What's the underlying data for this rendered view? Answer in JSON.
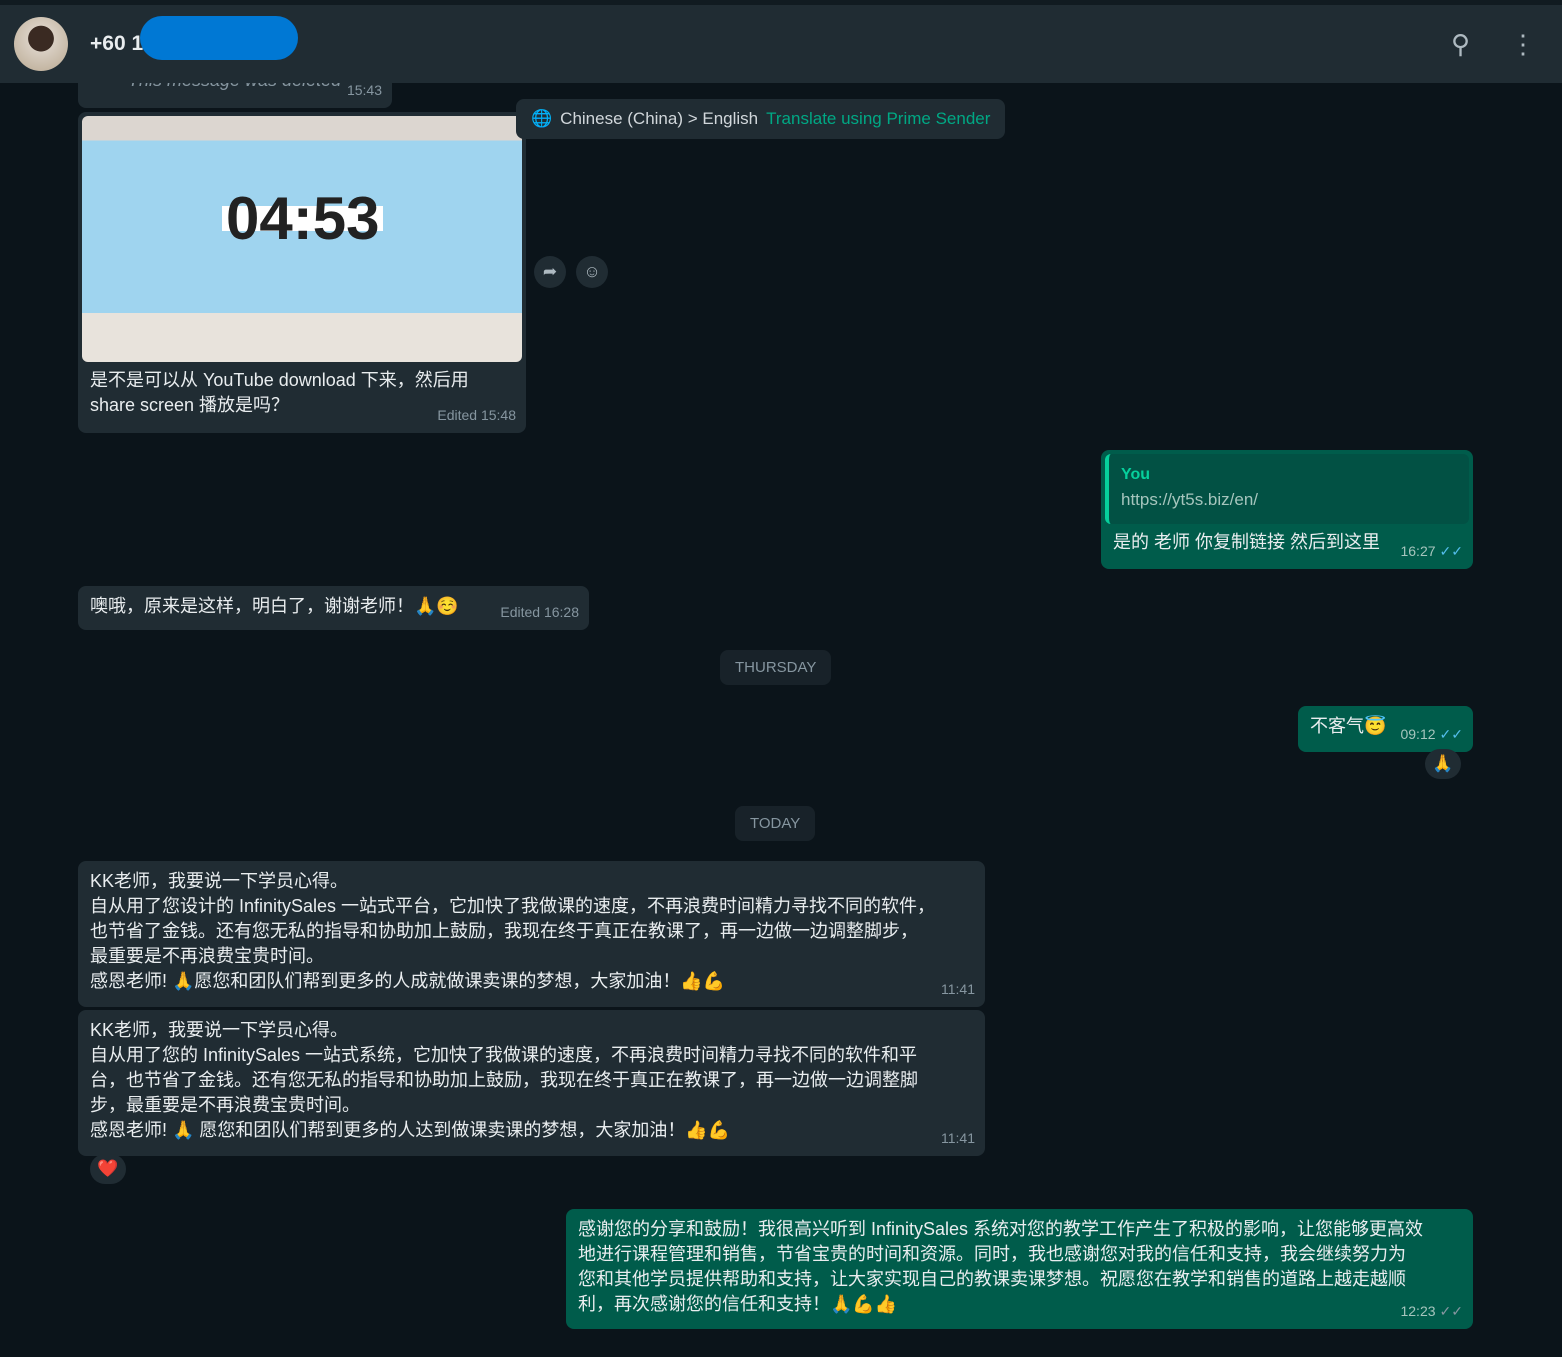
{
  "header": {
    "contact": "+60 1",
    "icons": [
      "search-icon",
      "menu-icon"
    ]
  },
  "messages": {
    "deleted": {
      "text": "This message was deleted",
      "time": "15:43"
    },
    "image_msg": {
      "timer": "04:53",
      "caption": "是不是可以从 YouTube download 下来，然后用 share screen 播放是吗？",
      "time": "Edited 15:48"
    },
    "translate": {
      "lang": "Chinese (China) > English",
      "link": "Translate using Prime Sender"
    },
    "reply1": {
      "quote_author": "You",
      "quote_text": "https://yt5s.biz/en/",
      "text": "是的 老师 你复制链接 然后到这里",
      "time": "16:27"
    },
    "in2": {
      "text": "噢哦，原来是这样，明白了，谢谢老师！🙏☺️",
      "time": "Edited 16:28"
    },
    "day1": "THURSDAY",
    "out2": {
      "text": "不客气😇",
      "time": "09:12",
      "reaction": "🙏"
    },
    "day2": "TODAY",
    "in3": {
      "lines": [
        "KK老师，我要说一下学员心得。",
        "自从用了您设计的 InfinitySales 一站式平台，它加快了我做课的速度，不再浪费时间精力寻找不同的软件，",
        "也节省了金钱。还有您无私的指导和协助加上鼓励，我现在终于真正在教课了，再一边做一边调整脚步，",
        "最重要是不再浪费宝贵时间。",
        "感恩老师! 🙏愿您和团队们帮到更多的人成就做课卖课的梦想，大家加油！👍💪"
      ],
      "time": "11:41"
    },
    "in4": {
      "lines": [
        "KK老师，我要说一下学员心得。",
        "自从用了您的 InfinitySales 一站式系统，它加快了我做课的速度，不再浪费时间精力寻找不同的软件和平",
        "台，也节省了金钱。还有您无私的指导和协助加上鼓励，我现在终于真正在教课了，再一边做一边调整脚",
        "步，最重要是不再浪费宝贵时间。",
        "感恩老师! 🙏 愿您和团队们帮到更多的人达到做课卖课的梦想，大家加油！👍💪"
      ],
      "time": "11:41",
      "reaction": "❤️"
    },
    "out3": {
      "lines": [
        "感谢您的分享和鼓励！我很高兴听到 InfinitySales 系统对您的教学工作产生了积极的影响，让您能够更高效",
        "地进行课程管理和销售，节省宝贵的时间和资源。同时，我也感谢您对我的信任和支持，我会继续努力为",
        "您和其他学员提供帮助和支持，让大家实现自己的教课卖课梦想。祝愿您在教学和销售的道路上越走越顺",
        "利，再次感谢您的信任和支持！🙏💪👍"
      ],
      "time": "12:23"
    }
  },
  "colors": {
    "bg": "#0b141a",
    "incoming": "#202c33",
    "outgoing": "#005c4b",
    "accent": "#00a884",
    "ticks": "#53bdeb",
    "redaction": "#0078d4"
  }
}
